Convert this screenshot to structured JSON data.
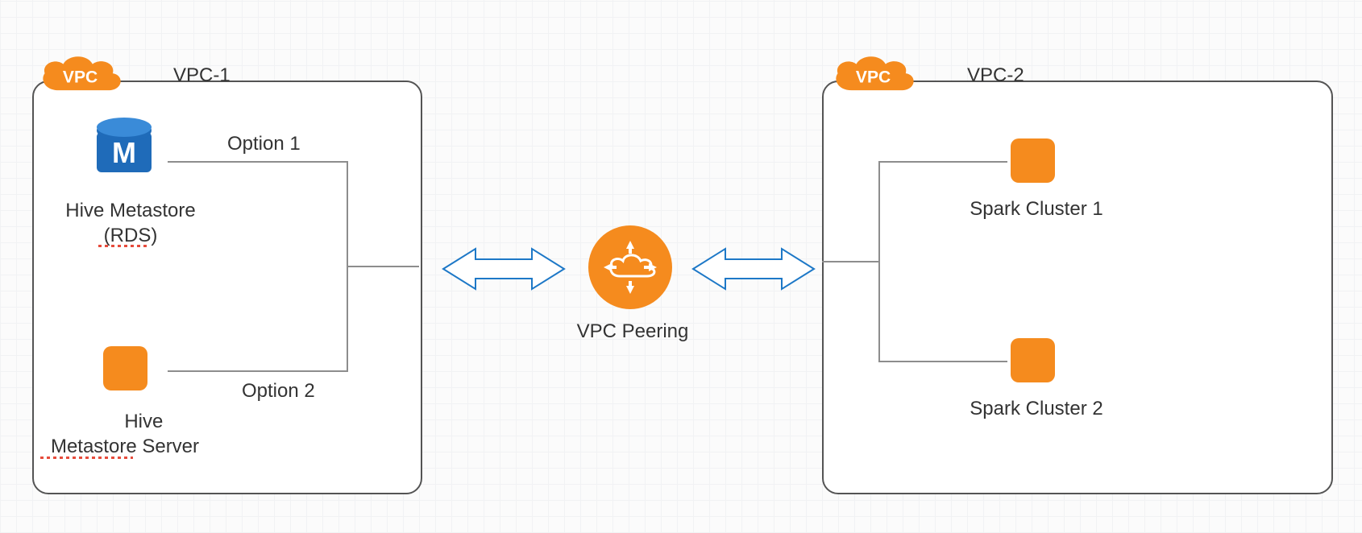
{
  "vpc1": {
    "badge_text": "VPC",
    "title": "VPC-1",
    "hive_rds_label": "Hive Metastore\n(RDS)",
    "hive_rds_db_letter": "M",
    "option1_label": "Option 1",
    "option2_label": "Option 2",
    "hive_server_label": "       Hive\nMetastore Server"
  },
  "vpc2": {
    "badge_text": "VPC",
    "title": "VPC-2",
    "spark1_label": "Spark Cluster 1",
    "spark2_label": "Spark Cluster 2"
  },
  "peering": {
    "label": "VPC Peering"
  },
  "colors": {
    "orange": "#f58b1e",
    "blue": "#1f6bb9",
    "line": "#8d8d8d",
    "arrow_stroke": "#1d78c7"
  }
}
